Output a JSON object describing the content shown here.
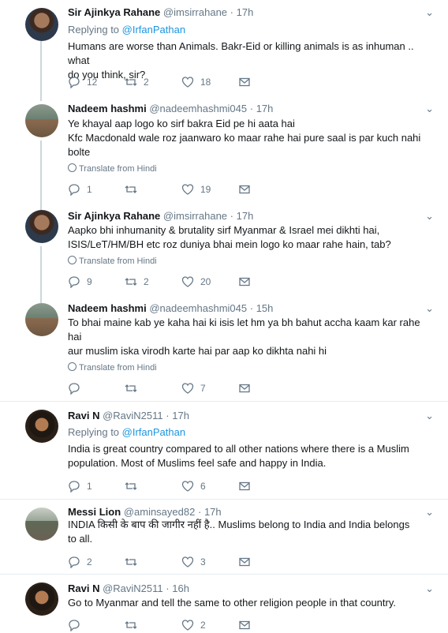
{
  "tweets": [
    {
      "name": "Sir Ajinkya Rahane",
      "handle": "@imsirrahane",
      "time": "17h",
      "replying_prefix": "Replying to",
      "replying_to": "@IrfanPathan",
      "lines": [
        "Humans are worse than Animals. Bakr-Eid or killing animals is as inhuman .. what",
        "do you think, sir?"
      ],
      "replies": "12",
      "retweets": "2",
      "likes": "18"
    },
    {
      "name": "Nadeem hashmi",
      "handle": "@nadeemhashmi045",
      "time": "17h",
      "lines": [
        "Ye khayal aap  logo ko sirf bakra Eid pe hi aata hai",
        "Kfc Macdonald wale roz  jaanwaro ko maar rahe hai pure saal is par kuch nahi",
        "bolte"
      ],
      "translate": "Translate from Hindi",
      "replies": "1",
      "retweets": "",
      "likes": "19"
    },
    {
      "name": "Sir Ajinkya Rahane",
      "handle": "@imsirrahane",
      "time": "17h",
      "lines": [
        "Aapko bhi inhumanity & brutality sirf Myanmar & Israel mei dikhti hai,",
        "ISIS/LeT/HM/BH etc roz duniya bhai mein logo ko maar rahe hain, tab?"
      ],
      "translate": "Translate from Hindi",
      "replies": "9",
      "retweets": "2",
      "likes": "20"
    },
    {
      "name": "Nadeem hashmi",
      "handle": "@nadeemhashmi045",
      "time": "15h",
      "lines": [
        "To bhai maine kab ye kaha hai ki isis let hm ya bh bahut accha kaam kar rahe",
        "hai",
        "aur muslim iska virodh karte hai par aap ko dikhta nahi hi"
      ],
      "translate": "Translate from Hindi",
      "replies": "",
      "retweets": "",
      "likes": "7"
    },
    {
      "name": "Ravi N",
      "handle": "@RaviN2511",
      "time": "17h",
      "replying_prefix": "Replying to",
      "replying_to": "@IrfanPathan",
      "lines": [
        "India is great country compared to all other nations where there is a Muslim",
        "population. Most of Muslims feel safe and happy in India."
      ],
      "replies": "1",
      "retweets": "",
      "likes": "6"
    },
    {
      "name": "Messi Lion",
      "handle": "@aminsayed82",
      "time": "17h",
      "lines": [
        "INDIA किसी के बाप की जागीर नहीं है.. Muslims belong to India and India belongs",
        "to all."
      ],
      "replies": "2",
      "retweets": "",
      "likes": "3"
    },
    {
      "name": "Ravi N",
      "handle": "@RaviN2511",
      "time": "16h",
      "lines": [
        "Go to Myanmar and tell the same to other religion people in that country."
      ],
      "replies": "",
      "retweets": "",
      "likes": "2"
    }
  ],
  "icons": [
    "reply-icon",
    "retweet-icon",
    "like-icon",
    "dm-icon",
    "globe-icon",
    "chevron-down-icon"
  ],
  "colors": {
    "link": "#1b95e0",
    "muted": "#657786",
    "divider": "#e6ecf0"
  }
}
